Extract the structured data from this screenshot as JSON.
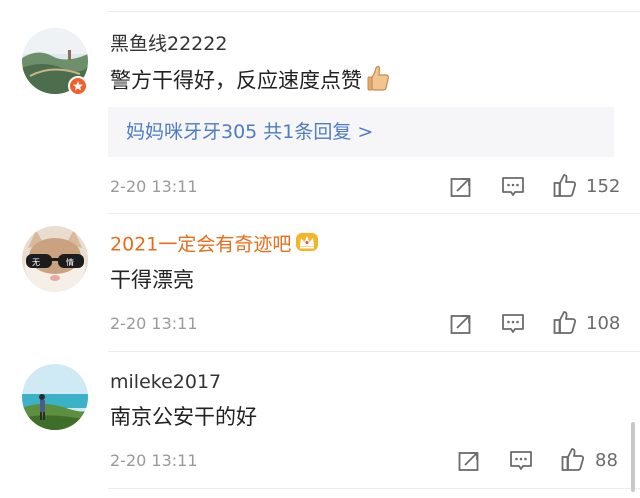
{
  "comments": [
    {
      "username": "黑鱼线22222",
      "text": "警方干得好，反应速度点赞",
      "reply": {
        "text": "妈妈咪牙牙305 共1条回复 >"
      },
      "time": "2-20 13:11",
      "likes": "152",
      "avatar_icon": "landscape-avatar-icon",
      "inline_icon": "thumbs-up-emoji-icon"
    },
    {
      "username": "2021一定会有奇迹吧",
      "text": "干得漂亮",
      "time": "2-20 13:11",
      "likes": "108",
      "avatar_icon": "cat-sunglasses-avatar-icon",
      "badge_icon": "crown-badge-icon",
      "avatar_text": [
        "无",
        "情"
      ]
    },
    {
      "username": "mileke2017",
      "text": "南京公安干的好",
      "time": "2-20 13:11",
      "likes": "88",
      "avatar_icon": "seaside-person-avatar-icon"
    }
  ],
  "icons": {
    "share": "share-icon",
    "comment": "comment-icon",
    "like": "like-icon"
  },
  "colors": {
    "vip_name": "#e96c18",
    "reply_link": "#4f7cc4",
    "meta": "#9a9a9a",
    "badge": "#f55f27"
  }
}
